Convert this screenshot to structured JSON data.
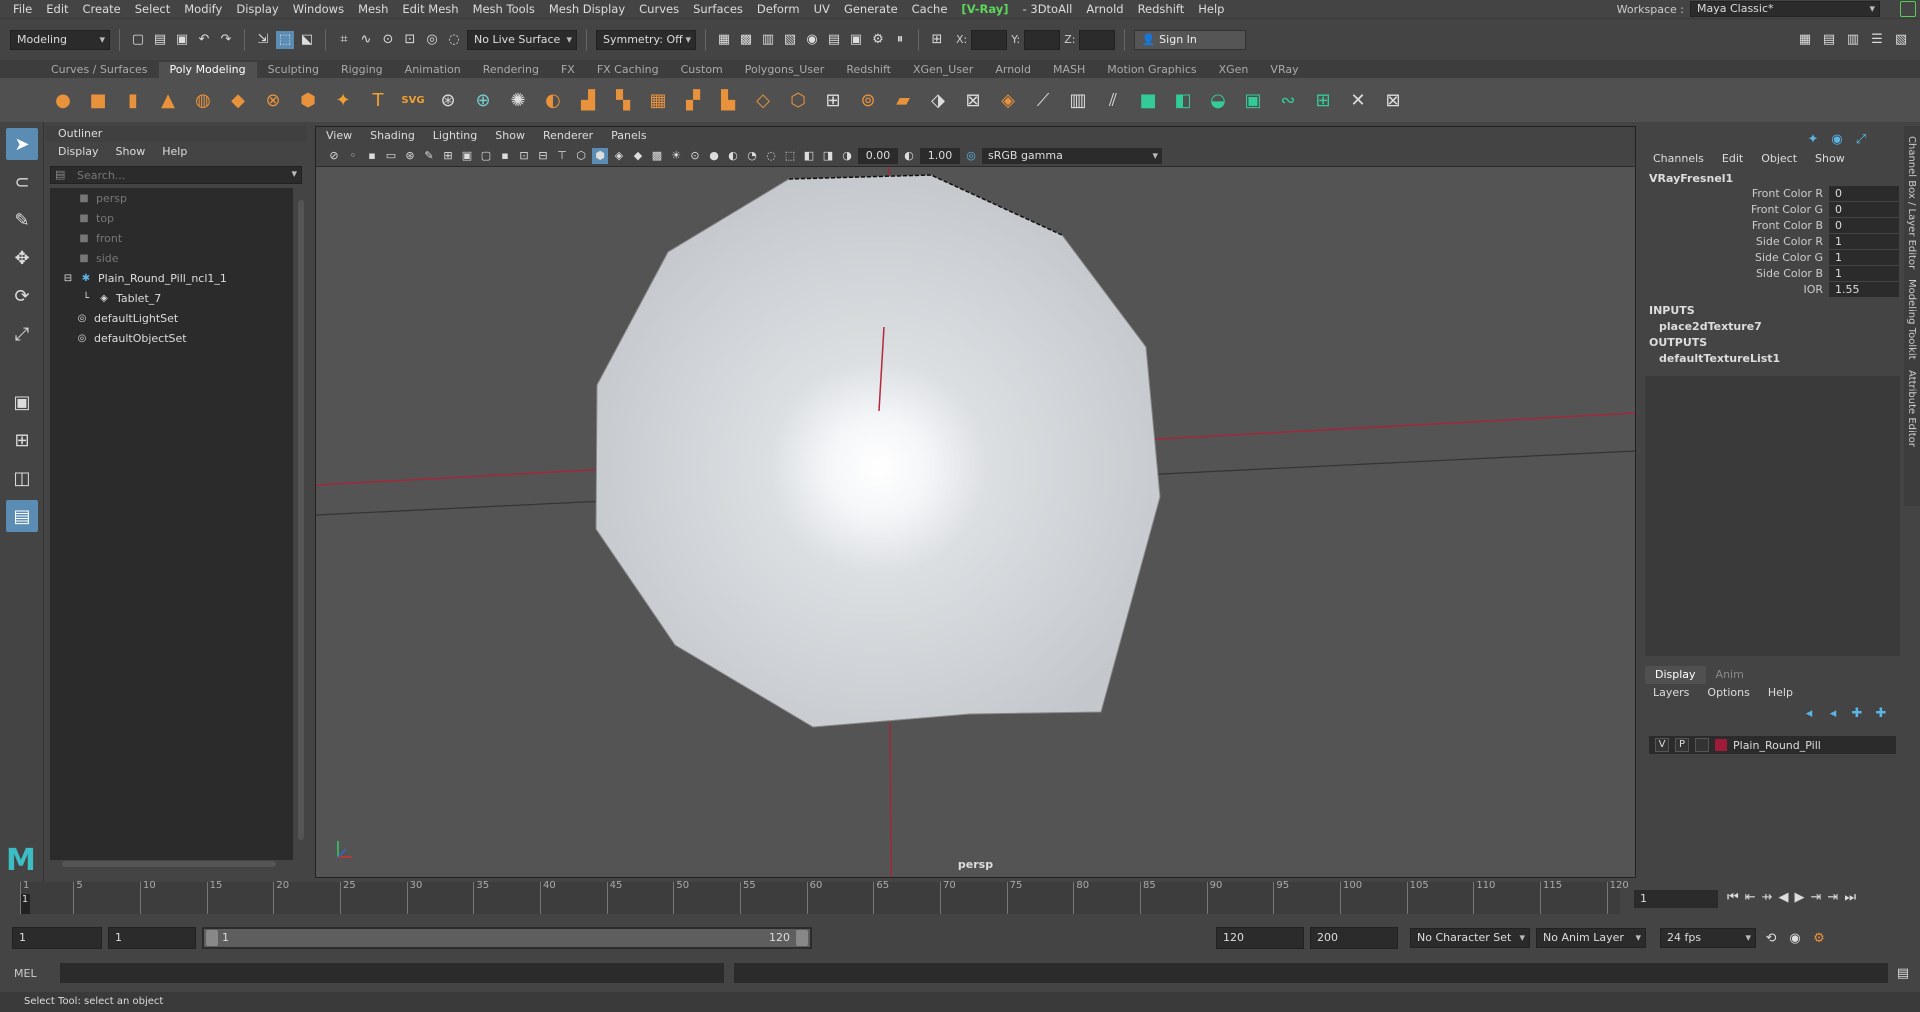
{
  "menubar": {
    "items": [
      "File",
      "Edit",
      "Create",
      "Select",
      "Modify",
      "Display",
      "Windows",
      "Mesh",
      "Edit Mesh",
      "Mesh Tools",
      "Mesh Display",
      "Curves",
      "Surfaces",
      "Deform",
      "UV",
      "Generate",
      "Cache"
    ],
    "vray": "V-Ray",
    "items2": [
      "3DtoAll",
      "Arnold",
      "Redshift",
      "Help"
    ],
    "workspace_label": "Workspace :",
    "workspace_value": "Maya Classic*"
  },
  "statusline": {
    "menuset": "Modeling",
    "live_surface": "No Live Surface",
    "symmetry": "Symmetry: Off",
    "x_label": "X:",
    "y_label": "Y:",
    "z_label": "Z:",
    "sign_in": "Sign In"
  },
  "shelf": {
    "tabs": [
      "Curves / Surfaces",
      "Poly Modeling",
      "Sculpting",
      "Rigging",
      "Animation",
      "Rendering",
      "FX",
      "FX Caching",
      "Custom",
      "Polygons_User",
      "Redshift",
      "XGen_User",
      "Arnold",
      "MASH",
      "Motion Graphics",
      "XGen",
      "VRay"
    ],
    "active_tab": "Poly Modeling"
  },
  "outliner": {
    "title": "Outliner",
    "menu": [
      "Display",
      "Show",
      "Help"
    ],
    "search_placeholder": "Search...",
    "items": [
      {
        "label": "persp",
        "dim": true
      },
      {
        "label": "top",
        "dim": true
      },
      {
        "label": "front",
        "dim": true
      },
      {
        "label": "side",
        "dim": true
      },
      {
        "label": "Plain_Round_Pill_ncl1_1",
        "dim": false
      },
      {
        "label": "Tablet_7",
        "dim": false
      },
      {
        "label": "defaultLightSet",
        "dim": false
      },
      {
        "label": "defaultObjectSet",
        "dim": false
      }
    ]
  },
  "viewport": {
    "menu": [
      "View",
      "Shading",
      "Lighting",
      "Show",
      "Renderer",
      "Panels"
    ],
    "exposure": "0.00",
    "gamma": "1.00",
    "colorspace": "sRGB gamma",
    "camera": "persp"
  },
  "channelbox": {
    "menu": [
      "Channels",
      "Edit",
      "Object",
      "Show"
    ],
    "node": "VRayFresnel1",
    "attrs": [
      {
        "label": "Front Color R",
        "value": "0"
      },
      {
        "label": "Front Color G",
        "value": "0"
      },
      {
        "label": "Front Color B",
        "value": "0"
      },
      {
        "label": "Side Color R",
        "value": "1"
      },
      {
        "label": "Side Color G",
        "value": "1"
      },
      {
        "label": "Side Color B",
        "value": "1"
      },
      {
        "label": "IOR",
        "value": "1.55"
      }
    ],
    "inputs_label": "INPUTS",
    "input_node": "place2dTexture7",
    "outputs_label": "OUTPUTS",
    "output_node": "defaultTextureList1",
    "side_tabs": [
      "Channel Box / Layer Editor",
      "Modeling Toolkit",
      "Attribute Editor"
    ]
  },
  "layers": {
    "tabs": [
      "Display",
      "Anim"
    ],
    "menu": [
      "Layers",
      "Options",
      "Help"
    ],
    "layer": {
      "v": "V",
      "p": "P",
      "name": "Plain_Round_Pill",
      "color": "#a01a3a"
    }
  },
  "timeline": {
    "ticks": [
      "1",
      "5",
      "10",
      "15",
      "20",
      "25",
      "30",
      "35",
      "40",
      "45",
      "50",
      "55",
      "60",
      "65",
      "70",
      "75",
      "80",
      "85",
      "90",
      "95",
      "100",
      "105",
      "110",
      "115",
      "120"
    ],
    "current_frame": "1",
    "start": "1",
    "start2": "1",
    "range_start": "1",
    "range_end": "120",
    "end": "120",
    "end2": "200",
    "character_set": "No Character Set",
    "anim_layer": "No Anim Layer",
    "fps": "24 fps"
  },
  "cmd": {
    "lang": "MEL",
    "help": "Select Tool: select an object"
  }
}
